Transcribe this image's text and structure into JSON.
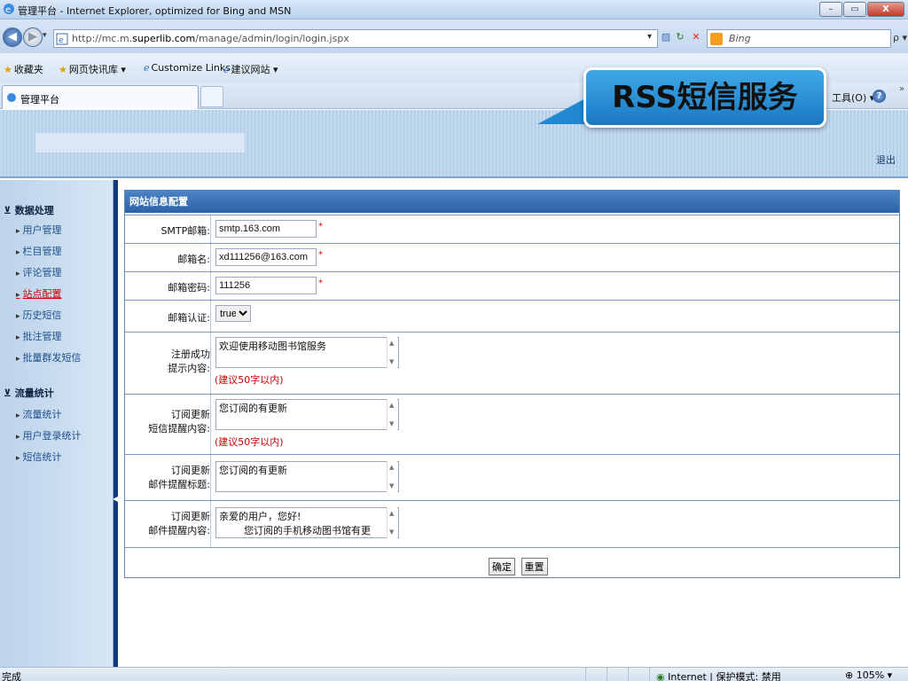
{
  "window": {
    "title": "管理平台 - Internet Explorer, optimized for Bing and MSN",
    "min_glyph": "–",
    "max_glyph": "▭",
    "close_glyph": "X"
  },
  "address": {
    "url_prefix": "http://mc.m.",
    "url_domain": "superlib.com",
    "url_path": "/manage/admin/login/login.jspx",
    "search_placeholder": "Bing",
    "search_glyph": "ρ ▾"
  },
  "favorites": {
    "label": "收藏夹",
    "items": [
      "网页快讯库 ▾",
      "Customize Links",
      "建议网站 ▾"
    ]
  },
  "tab": {
    "label": "管理平台"
  },
  "commandbar": {
    "tools_label": "工具(O) ▾",
    "help_glyph": "?",
    "more_glyph": "»"
  },
  "callout": {
    "text": "RSS短信服务",
    "color": "#1b78c2"
  },
  "banner": {
    "logout": "退出"
  },
  "sidebar": {
    "groups": [
      {
        "title": "⊻ 数据处理",
        "items": [
          {
            "label": "用户管理",
            "active": false
          },
          {
            "label": "栏目管理",
            "active": false
          },
          {
            "label": "评论管理",
            "active": false
          },
          {
            "label": "站点配置",
            "active": true
          },
          {
            "label": "历史短信",
            "active": false
          },
          {
            "label": "批注管理",
            "active": false
          },
          {
            "label": "批量群发短信",
            "active": false
          }
        ]
      },
      {
        "title": "⊻ 流量统计",
        "items": [
          {
            "label": "流量统计",
            "active": false
          },
          {
            "label": "用户登录统计",
            "active": false
          },
          {
            "label": "短信统计",
            "active": false
          }
        ]
      }
    ]
  },
  "form": {
    "header": "网站信息配置",
    "smtp": {
      "label": "SMTP邮箱:",
      "value": "smtp.163.com"
    },
    "mail_name": {
      "label": "邮箱名:",
      "value": "xd111256@163.com"
    },
    "mail_password": {
      "label": "邮箱密码:",
      "value": "111256"
    },
    "mail_auth": {
      "label": "邮箱认证:",
      "value": "true",
      "options": [
        "true",
        "false"
      ]
    },
    "register_tip": {
      "label_line1": "注册成功",
      "label_line2": "提示内容:",
      "value": "欢迎使用移动图书馆服务",
      "hint": "(建议50字以内)"
    },
    "sms_reminder": {
      "label_line1": "订阅更新",
      "label_line2": "短信提醒内容:",
      "value": "您订阅的有更新",
      "hint": "(建议50字以内)"
    },
    "mail_subject": {
      "label_line1": "订阅更新",
      "label_line2": "邮件提醒标题:",
      "value": "您订阅的有更新"
    },
    "mail_content": {
      "label_line1": "订阅更新",
      "label_line2": "邮件提醒内容:",
      "value": "亲爱的用户，您好!\n        您订阅的手机移动图书馆有更"
    },
    "required_mark": "*",
    "confirm_label": "确定",
    "reset_label": "重置"
  },
  "status": {
    "left": "完成",
    "zone": "Internet | 保护模式: 禁用",
    "zoom": "⊕ 105% ▾"
  }
}
